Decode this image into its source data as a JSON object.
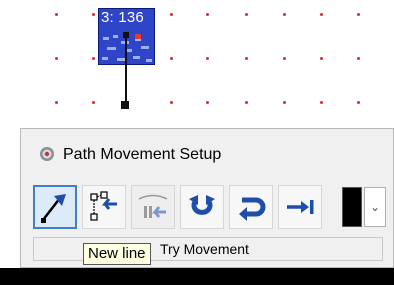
{
  "canvas": {
    "node": {
      "label": "3: 136"
    }
  },
  "dialog": {
    "title": "Path Movement Setup",
    "toolbar": {
      "buttons": [
        {
          "name": "new-line"
        },
        {
          "name": "insert-node"
        },
        {
          "name": "add-point"
        },
        {
          "name": "loop"
        },
        {
          "name": "return"
        },
        {
          "name": "go-to-end"
        }
      ],
      "color_swatch": "#000000",
      "dropdown_symbol": "⌄"
    },
    "status": "Try Movement",
    "tooltip": "New line"
  },
  "colors": {
    "node_fill": "#2f45c8",
    "icon_blue": "#1d4fa8",
    "grid_dot": "#d0303a",
    "tooltip_bg": "#ffffe1"
  }
}
